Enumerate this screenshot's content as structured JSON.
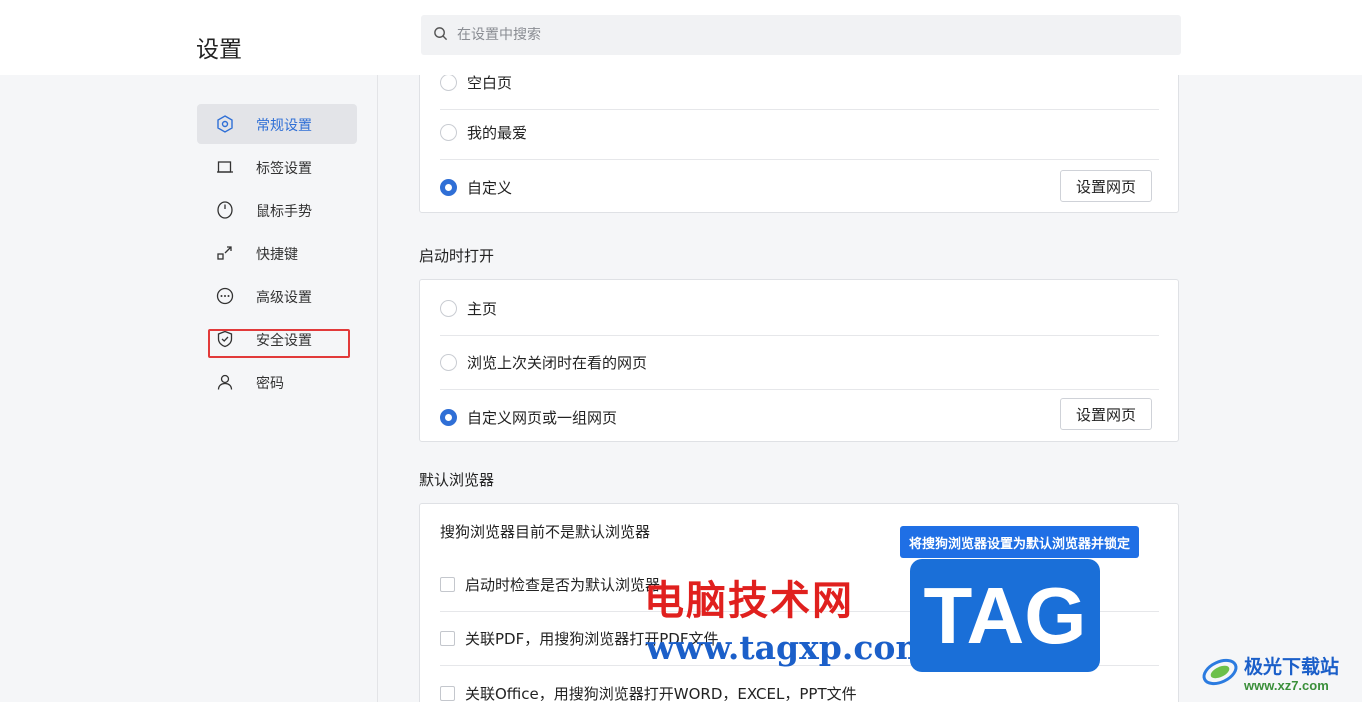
{
  "header": {
    "title": "设置",
    "search_placeholder": "在设置中搜索"
  },
  "sidebar": {
    "items": [
      {
        "label": "常规设置",
        "icon": "hexagon-gear-icon",
        "active": true
      },
      {
        "label": "标签设置",
        "icon": "tab-icon",
        "active": false
      },
      {
        "label": "鼠标手势",
        "icon": "mouse-icon",
        "active": false
      },
      {
        "label": "快捷键",
        "icon": "shortcut-arrow-icon",
        "active": false
      },
      {
        "label": "高级设置",
        "icon": "more-dots-icon",
        "active": false
      },
      {
        "label": "安全设置",
        "icon": "shield-icon",
        "active": false
      },
      {
        "label": "密码",
        "icon": "user-icon",
        "active": false
      }
    ]
  },
  "homepage_card": {
    "options": [
      {
        "label": "空白页",
        "checked": false
      },
      {
        "label": "我的最爱",
        "checked": false
      },
      {
        "label": "自定义",
        "checked": true
      }
    ],
    "button": "设置网页"
  },
  "startup": {
    "title": "启动时打开",
    "options": [
      {
        "label": "主页",
        "checked": false
      },
      {
        "label": "浏览上次关闭时在看的网页",
        "checked": false
      },
      {
        "label": "自定义网页或一组网页",
        "checked": true
      }
    ],
    "button": "设置网页"
  },
  "default_browser": {
    "title": "默认浏览器",
    "status": "搜狗浏览器目前不是默认浏览器",
    "set_default_button": "将搜狗浏览器设置为默认浏览器并锁定",
    "checks": [
      {
        "label": "启动时检查是否为默认浏览器",
        "checked": false
      },
      {
        "label": "关联PDF，用搜狗浏览器打开PDF文件",
        "checked": false
      },
      {
        "label": "关联Office，用搜狗浏览器打开WORD，EXCEL，PPT文件",
        "checked": false
      }
    ]
  },
  "watermark": {
    "site_name": "电脑技术网",
    "site_url": "www.tagxp.com",
    "tag": "TAG",
    "logo_name": "极光下载站",
    "logo_url": "www.xz7.com"
  },
  "colors": {
    "accent": "#2f6fd6",
    "primary_button": "#1f6fe5",
    "highlight_box": "#e23a3a"
  }
}
